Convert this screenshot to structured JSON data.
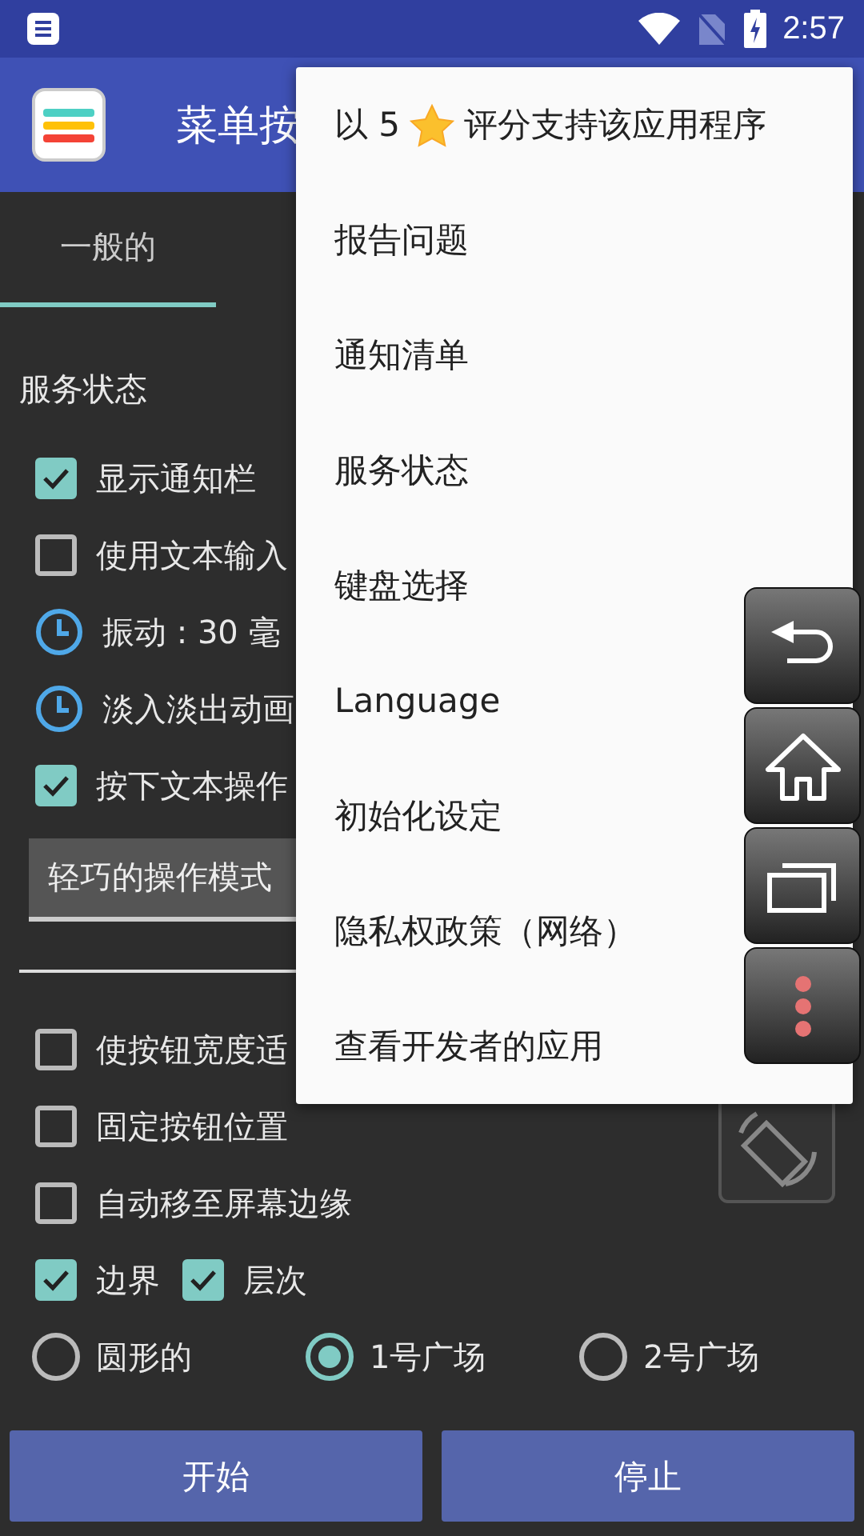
{
  "status_bar": {
    "time": "2:57"
  },
  "app_bar": {
    "title": "菜单按"
  },
  "tabs": [
    {
      "label": "一般的",
      "selected": true
    }
  ],
  "section_title": "服务状态",
  "options_top": [
    {
      "kind": "checkbox",
      "label": "显示通知栏",
      "checked": true
    },
    {
      "kind": "checkbox",
      "label": "使用文本输入",
      "checked": false
    },
    {
      "kind": "timer",
      "label": "振动 : 30 毫"
    },
    {
      "kind": "timer",
      "label": "淡入淡出动画"
    },
    {
      "kind": "checkbox",
      "label": "按下文本操作",
      "checked": true
    }
  ],
  "mode_dropdown": {
    "value": "轻巧的操作模式"
  },
  "options_bottom": [
    {
      "label": "使按钮宽度适",
      "checked": false
    },
    {
      "label": "固定按钮位置",
      "checked": false
    },
    {
      "label": "自动移至屏幕边缘",
      "checked": false
    }
  ],
  "pair_options": [
    {
      "label": "边界",
      "checked": true
    },
    {
      "label": "层次",
      "checked": true
    }
  ],
  "shape_options": [
    {
      "label": "圆形的",
      "selected": false
    },
    {
      "label": "1号广场",
      "selected": true
    },
    {
      "label": "2号广场",
      "selected": false
    }
  ],
  "buttons": [
    "开始",
    "停止"
  ],
  "menu": {
    "items": [
      {
        "kind": "rating",
        "before": "以 5",
        "after": "评分支持该应用程序"
      },
      {
        "kind": "text",
        "label": "报告问题"
      },
      {
        "kind": "text",
        "label": "通知清单"
      },
      {
        "kind": "text",
        "label": "服务状态"
      },
      {
        "kind": "text",
        "label": "键盘选择"
      },
      {
        "kind": "text",
        "label": "Language"
      },
      {
        "kind": "text",
        "label": "初始化设定"
      },
      {
        "kind": "text",
        "label": "隐私权政策（网络）"
      },
      {
        "kind": "text",
        "label": "查看开发者的应用"
      }
    ]
  },
  "floating_buttons": [
    {
      "kind": "back"
    },
    {
      "kind": "home"
    },
    {
      "kind": "recents"
    },
    {
      "kind": "more"
    }
  ]
}
